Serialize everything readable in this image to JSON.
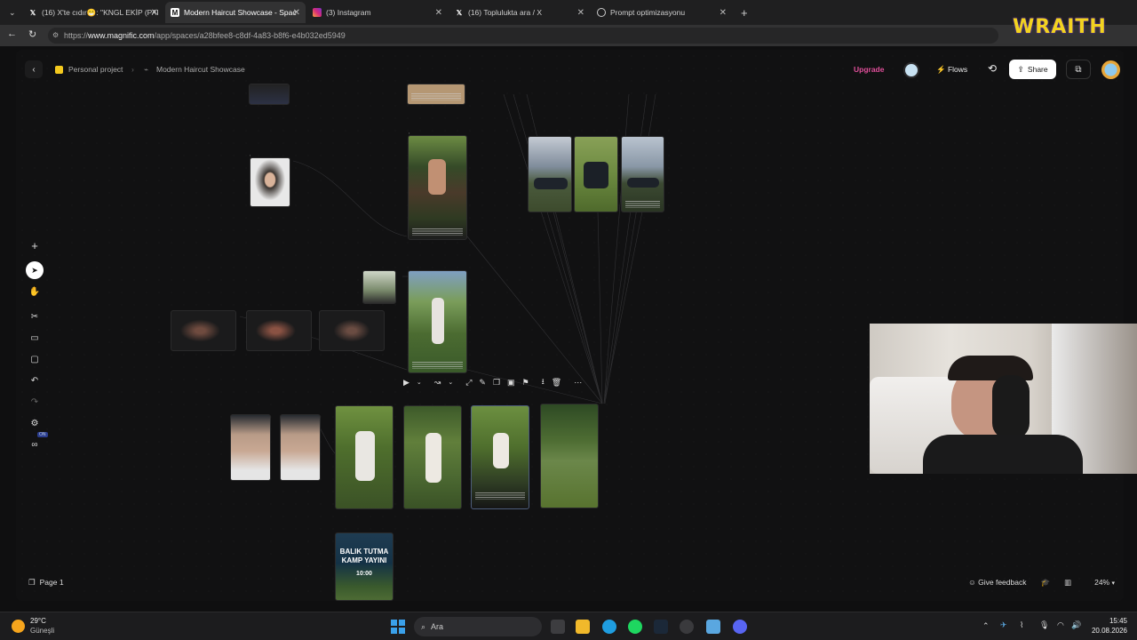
{
  "browser": {
    "tabs": [
      {
        "title": "(16) X'te cıdır😁: \"KNGL EKİP (PAR",
        "icon": "x-icon"
      },
      {
        "title": "Modern Haircut Showcase - Spac",
        "icon": "magnific-icon"
      },
      {
        "title": "(3) Instagram",
        "icon": "instagram-icon"
      },
      {
        "title": "(16) Toplulukta ara / X",
        "icon": "x-icon"
      },
      {
        "title": "Prompt optimizasyonu",
        "icon": "chatgpt-icon"
      }
    ],
    "url_prefix": "https://",
    "url_host": "www.magnific.com",
    "url_path": "/app/spaces/a28bfee8-c8df-4a83-b8f6-e4b032ed5949"
  },
  "app": {
    "breadcrumb": {
      "project": "Personal project",
      "space": "Modern Haircut Showcase"
    },
    "header": {
      "upgrade": "Upgrade",
      "flows": "Flows",
      "share": "Share"
    },
    "page_label": "Page 1",
    "feedback": "Give feedback",
    "zoom": "24%",
    "toggle_badge": "ON"
  },
  "canvas": {
    "poster": {
      "line1": "BALIK TUTMA",
      "line2": "KAMP YAYINI",
      "time": "10:00"
    }
  },
  "overlay": {
    "brand": "WRAITH"
  },
  "taskbar": {
    "weather_temp": "29°C",
    "weather_desc": "Güneşli",
    "search_placeholder": "Ara",
    "time": "15:45",
    "date": "20.08.2026"
  },
  "colors": {
    "accent_upgrade": "#e04f9a",
    "overlay_brand": "#f2d320"
  }
}
